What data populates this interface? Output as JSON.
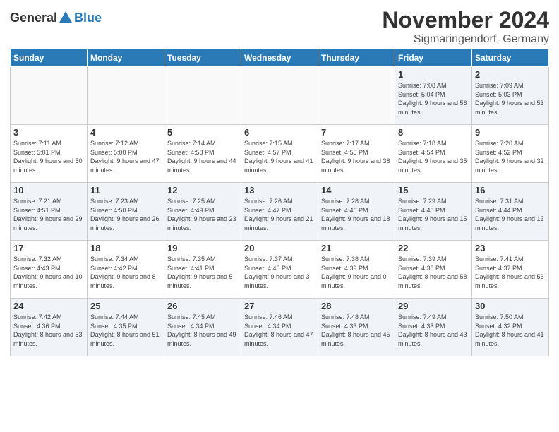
{
  "header": {
    "logo_general": "General",
    "logo_blue": "Blue",
    "title": "November 2024",
    "subtitle": "Sigmaringendorf, Germany"
  },
  "weekdays": [
    "Sunday",
    "Monday",
    "Tuesday",
    "Wednesday",
    "Thursday",
    "Friday",
    "Saturday"
  ],
  "weeks": [
    [
      {
        "day": "",
        "info": ""
      },
      {
        "day": "",
        "info": ""
      },
      {
        "day": "",
        "info": ""
      },
      {
        "day": "",
        "info": ""
      },
      {
        "day": "",
        "info": ""
      },
      {
        "day": "1",
        "info": "Sunrise: 7:08 AM\nSunset: 5:04 PM\nDaylight: 9 hours and 56 minutes."
      },
      {
        "day": "2",
        "info": "Sunrise: 7:09 AM\nSunset: 5:03 PM\nDaylight: 9 hours and 53 minutes."
      }
    ],
    [
      {
        "day": "3",
        "info": "Sunrise: 7:11 AM\nSunset: 5:01 PM\nDaylight: 9 hours and 50 minutes."
      },
      {
        "day": "4",
        "info": "Sunrise: 7:12 AM\nSunset: 5:00 PM\nDaylight: 9 hours and 47 minutes."
      },
      {
        "day": "5",
        "info": "Sunrise: 7:14 AM\nSunset: 4:58 PM\nDaylight: 9 hours and 44 minutes."
      },
      {
        "day": "6",
        "info": "Sunrise: 7:15 AM\nSunset: 4:57 PM\nDaylight: 9 hours and 41 minutes."
      },
      {
        "day": "7",
        "info": "Sunrise: 7:17 AM\nSunset: 4:55 PM\nDaylight: 9 hours and 38 minutes."
      },
      {
        "day": "8",
        "info": "Sunrise: 7:18 AM\nSunset: 4:54 PM\nDaylight: 9 hours and 35 minutes."
      },
      {
        "day": "9",
        "info": "Sunrise: 7:20 AM\nSunset: 4:52 PM\nDaylight: 9 hours and 32 minutes."
      }
    ],
    [
      {
        "day": "10",
        "info": "Sunrise: 7:21 AM\nSunset: 4:51 PM\nDaylight: 9 hours and 29 minutes."
      },
      {
        "day": "11",
        "info": "Sunrise: 7:23 AM\nSunset: 4:50 PM\nDaylight: 9 hours and 26 minutes."
      },
      {
        "day": "12",
        "info": "Sunrise: 7:25 AM\nSunset: 4:49 PM\nDaylight: 9 hours and 23 minutes."
      },
      {
        "day": "13",
        "info": "Sunrise: 7:26 AM\nSunset: 4:47 PM\nDaylight: 9 hours and 21 minutes."
      },
      {
        "day": "14",
        "info": "Sunrise: 7:28 AM\nSunset: 4:46 PM\nDaylight: 9 hours and 18 minutes."
      },
      {
        "day": "15",
        "info": "Sunrise: 7:29 AM\nSunset: 4:45 PM\nDaylight: 9 hours and 15 minutes."
      },
      {
        "day": "16",
        "info": "Sunrise: 7:31 AM\nSunset: 4:44 PM\nDaylight: 9 hours and 13 minutes."
      }
    ],
    [
      {
        "day": "17",
        "info": "Sunrise: 7:32 AM\nSunset: 4:43 PM\nDaylight: 9 hours and 10 minutes."
      },
      {
        "day": "18",
        "info": "Sunrise: 7:34 AM\nSunset: 4:42 PM\nDaylight: 9 hours and 8 minutes."
      },
      {
        "day": "19",
        "info": "Sunrise: 7:35 AM\nSunset: 4:41 PM\nDaylight: 9 hours and 5 minutes."
      },
      {
        "day": "20",
        "info": "Sunrise: 7:37 AM\nSunset: 4:40 PM\nDaylight: 9 hours and 3 minutes."
      },
      {
        "day": "21",
        "info": "Sunrise: 7:38 AM\nSunset: 4:39 PM\nDaylight: 9 hours and 0 minutes."
      },
      {
        "day": "22",
        "info": "Sunrise: 7:39 AM\nSunset: 4:38 PM\nDaylight: 8 hours and 58 minutes."
      },
      {
        "day": "23",
        "info": "Sunrise: 7:41 AM\nSunset: 4:37 PM\nDaylight: 8 hours and 56 minutes."
      }
    ],
    [
      {
        "day": "24",
        "info": "Sunrise: 7:42 AM\nSunset: 4:36 PM\nDaylight: 8 hours and 53 minutes."
      },
      {
        "day": "25",
        "info": "Sunrise: 7:44 AM\nSunset: 4:35 PM\nDaylight: 8 hours and 51 minutes."
      },
      {
        "day": "26",
        "info": "Sunrise: 7:45 AM\nSunset: 4:34 PM\nDaylight: 8 hours and 49 minutes."
      },
      {
        "day": "27",
        "info": "Sunrise: 7:46 AM\nSunset: 4:34 PM\nDaylight: 8 hours and 47 minutes."
      },
      {
        "day": "28",
        "info": "Sunrise: 7:48 AM\nSunset: 4:33 PM\nDaylight: 8 hours and 45 minutes."
      },
      {
        "day": "29",
        "info": "Sunrise: 7:49 AM\nSunset: 4:33 PM\nDaylight: 8 hours and 43 minutes."
      },
      {
        "day": "30",
        "info": "Sunrise: 7:50 AM\nSunset: 4:32 PM\nDaylight: 8 hours and 41 minutes."
      }
    ]
  ]
}
